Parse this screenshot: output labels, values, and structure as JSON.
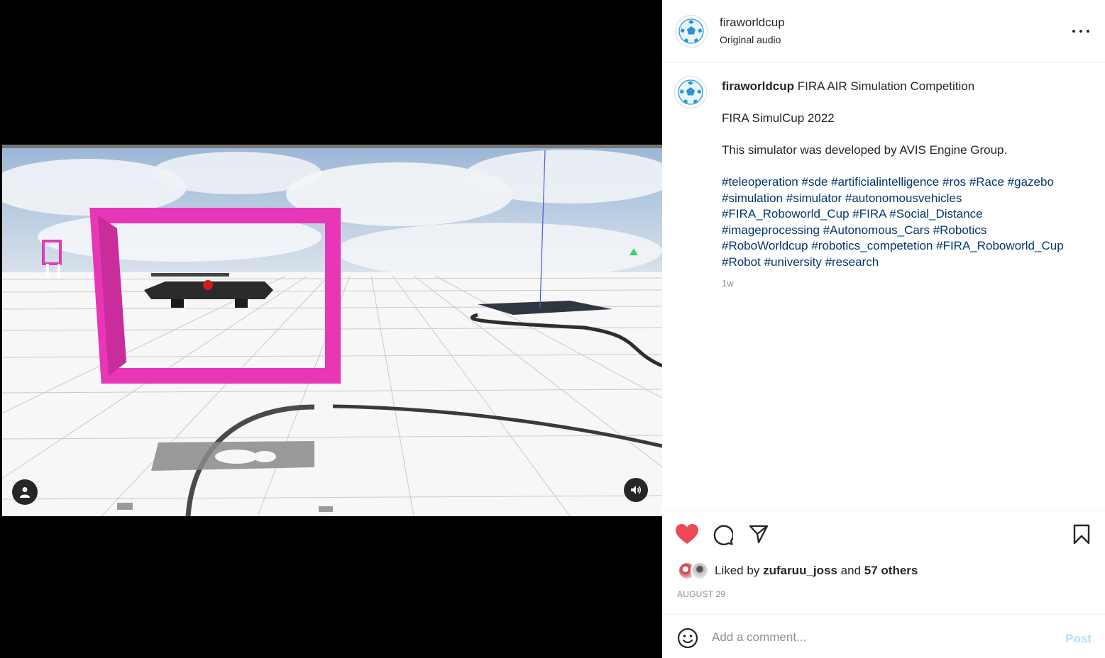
{
  "header": {
    "username": "firaworldcup",
    "audio": "Original audio",
    "more_icon": "more-horizontal-icon"
  },
  "caption": {
    "username": "firaworldcup",
    "title": "FIRA AIR Simulation Competition",
    "line2": "FIRA SimulCup 2022",
    "line3": "This simulator was developed by AVIS Engine Group.",
    "hashtags": [
      "#teleoperation",
      "#sde",
      "#artificialintelligence",
      "#ros",
      "#Race",
      "#gazebo",
      "#simulation",
      "#simulator",
      "#autonomousvehicles",
      "#FIRA_Roboworld_Cup",
      "#FIRA",
      "#Social_Distance",
      "#imageprocessing",
      "#Autonomous_Cars",
      "#Robotics",
      "#RoboWorldcup",
      "#robotics_competetion",
      "#FIRA_Roboworld_Cup",
      "#Robot",
      "#university",
      "#research"
    ],
    "time_ago": "1w"
  },
  "actions": {
    "like_icon": "heart-filled-icon",
    "comment_icon": "comment-icon",
    "share_icon": "share-icon",
    "save_icon": "bookmark-icon",
    "like_color": "#ed4956"
  },
  "likes": {
    "prefix": "Liked by",
    "user": "zufaruu_joss",
    "and": "and",
    "others": "57 others"
  },
  "post_date": "AUGUST 29",
  "comment": {
    "placeholder": "Add a comment...",
    "post_label": "Post"
  },
  "video": {
    "tag_icon": "user-tag-icon",
    "mute_icon": "sound-on-icon"
  }
}
